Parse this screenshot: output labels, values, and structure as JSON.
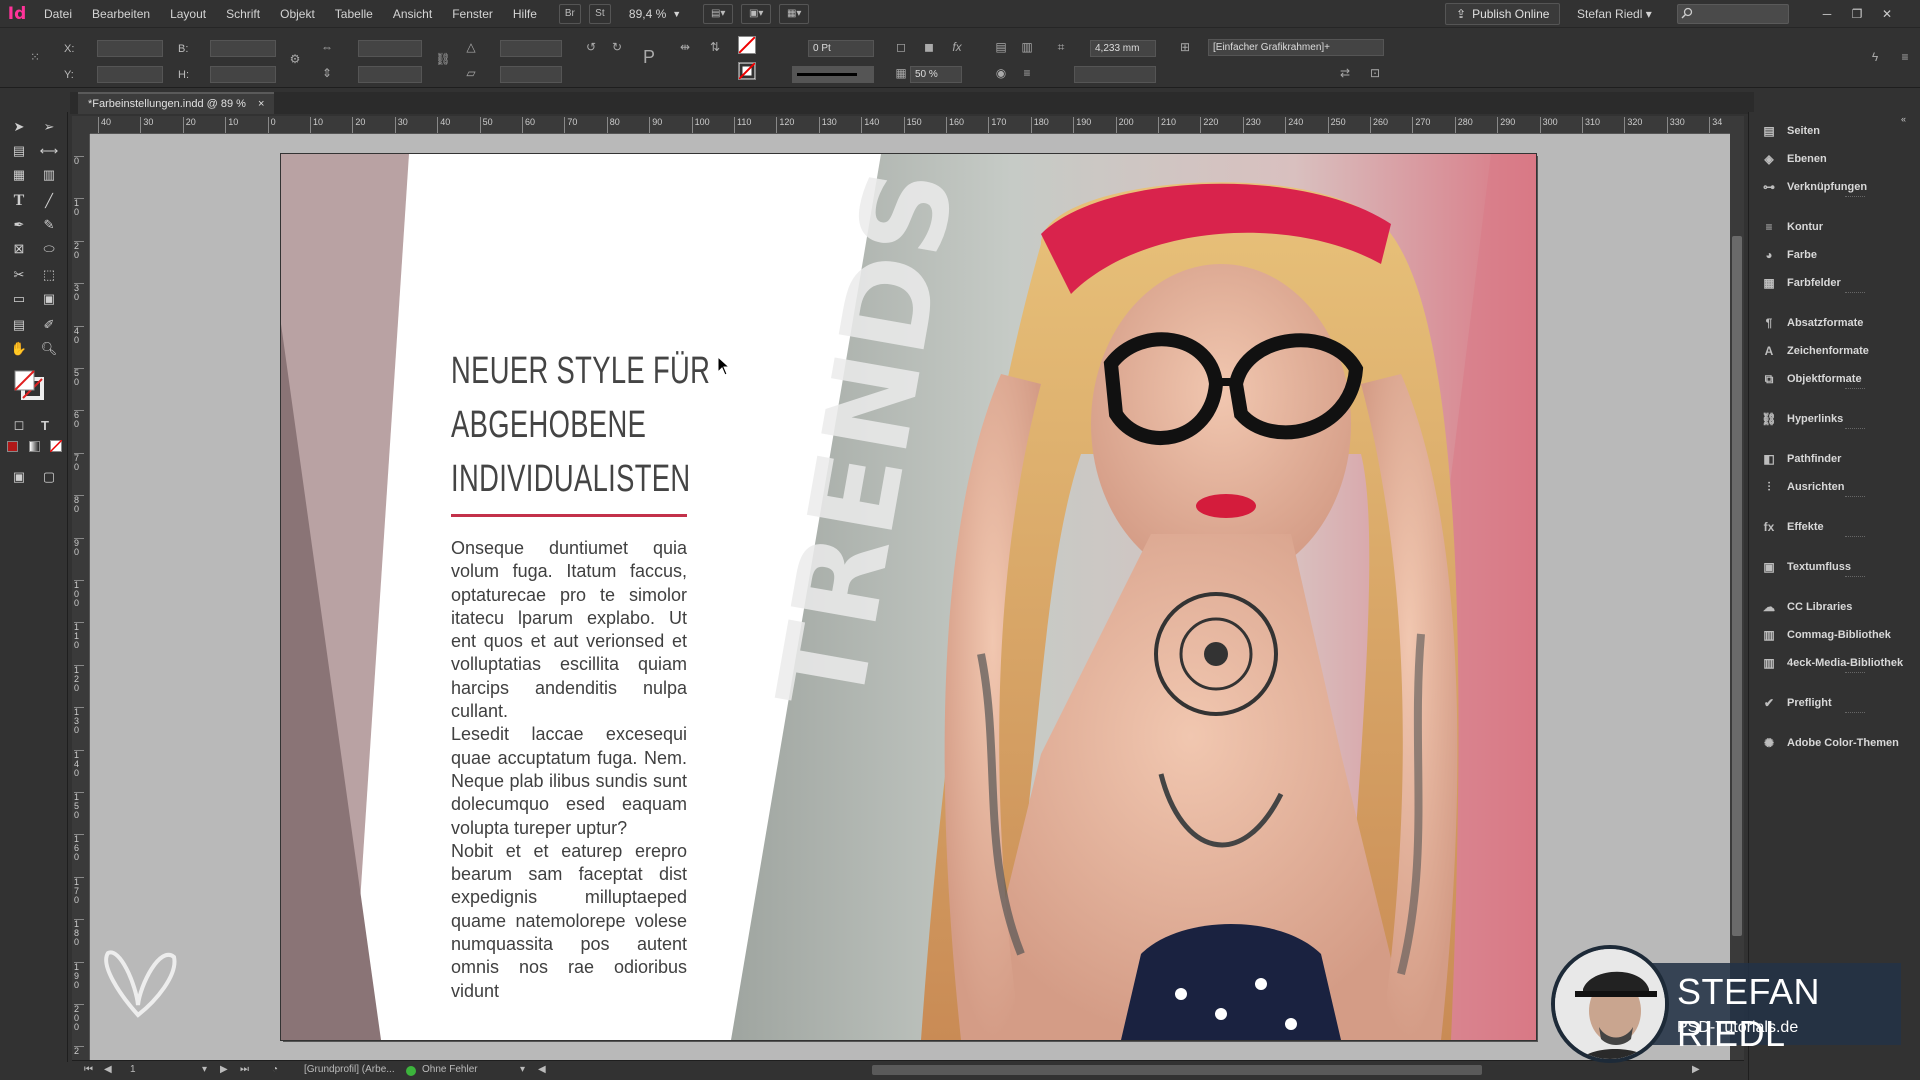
{
  "app": {
    "logo": "Id"
  },
  "menu": [
    "Datei",
    "Bearbeiten",
    "Layout",
    "Schrift",
    "Objekt",
    "Tabelle",
    "Ansicht",
    "Fenster",
    "Hilfe"
  ],
  "menubar": {
    "bridge_btn": "Br",
    "stock_btn": "St",
    "zoom": "89,4 %",
    "publish_label": "Publish Online",
    "user": "Stefan Riedl"
  },
  "control": {
    "x_label": "X:",
    "y_label": "Y:",
    "b_label": "B:",
    "h_label": "H:",
    "stroke_weight": "0 Pt",
    "opacity": "50 %",
    "size_field": "4,233 mm",
    "object_style": "[Einfacher Grafikrahmen]+"
  },
  "tab": {
    "title": "*Farbeinstellungen.indd @ 89 %",
    "close": "×"
  },
  "ruler": {
    "h_ticks": [
      "40",
      "30",
      "20",
      "10",
      "0",
      "10",
      "20",
      "30",
      "40",
      "50",
      "60",
      "70",
      "80",
      "90",
      "100",
      "110",
      "120",
      "130",
      "140",
      "150",
      "160",
      "170",
      "180",
      "190",
      "200",
      "210",
      "220",
      "230",
      "240",
      "250",
      "260",
      "270",
      "280",
      "290",
      "300",
      "310",
      "320",
      "330",
      "34"
    ],
    "v_ticks": [
      "0",
      "1 0",
      "2 0",
      "3 0",
      "4 0",
      "5 0",
      "6 0",
      "7 0",
      "8 0",
      "9 0",
      "1 0 0",
      "1 1 0",
      "1 2 0",
      "1 3 0",
      "1 4 0",
      "1 5 0",
      "1 6 0",
      "1 7 0",
      "1 8 0",
      "1 9 0",
      "2 0 0",
      "2"
    ]
  },
  "document": {
    "headline": [
      "NEUER STYLE FÜR",
      "ABGEHOBENE",
      "INDIVIDUALISTEN"
    ],
    "body_paragraphs": [
      "Onseque duntiumet quia volum fuga. Itatum faccus, optaturecae pro te simolor itatecu lparum explabo. Ut ent quos et aut verionsed et volluptatias escillita quiam harcips andenditis nulpa cullant.",
      "Lesedit laccae excesequi quae accuptatum fuga. Nem. Neque plab ilibus sundis sunt dolecumquo esed eaquam volupta tureper uptur?",
      "Nobit et et eaturep erepro bearum sam faceptat dist expedignis milluptaeped quame natemolorepe volese numquassita pos autent omnis nos rae odioribus vidunt"
    ],
    "vertical_word": "TRENDS",
    "accent_color": "#c3314a"
  },
  "statusbar": {
    "page": "1",
    "profile": "[Grundprofil] (Arbe...",
    "preflight": "Ohne Fehler",
    "preflight_color": "#3cb43c"
  },
  "panels": [
    {
      "label": "Seiten",
      "icon": "pages-icon"
    },
    {
      "label": "Ebenen",
      "icon": "layers-icon"
    },
    {
      "label": "Verknüpfungen",
      "icon": "links-icon"
    },
    {
      "label": "Kontur",
      "icon": "stroke-icon"
    },
    {
      "label": "Farbe",
      "icon": "color-icon"
    },
    {
      "label": "Farbfelder",
      "icon": "swatches-icon"
    },
    {
      "label": "Absatzformate",
      "icon": "paragraph-styles-icon"
    },
    {
      "label": "Zeichenformate",
      "icon": "character-styles-icon"
    },
    {
      "label": "Objektformate",
      "icon": "object-styles-icon"
    },
    {
      "label": "Hyperlinks",
      "icon": "hyperlinks-icon"
    },
    {
      "label": "Pathfinder",
      "icon": "pathfinder-icon"
    },
    {
      "label": "Ausrichten",
      "icon": "align-icon"
    },
    {
      "label": "Effekte",
      "icon": "effects-icon"
    },
    {
      "label": "Textumfluss",
      "icon": "text-wrap-icon"
    },
    {
      "label": "CC Libraries",
      "icon": "cc-libraries-icon"
    },
    {
      "label": "Commag-Bibliothek",
      "icon": "library-icon"
    },
    {
      "label": "4eck-Media-Bibliothek",
      "icon": "library-icon"
    },
    {
      "label": "Preflight",
      "icon": "preflight-icon"
    },
    {
      "label": "Adobe Color-Themen",
      "icon": "color-themes-icon"
    }
  ],
  "presenter": {
    "name": "STEFAN RIEDL",
    "site": "PSD-Tutorials.de"
  }
}
